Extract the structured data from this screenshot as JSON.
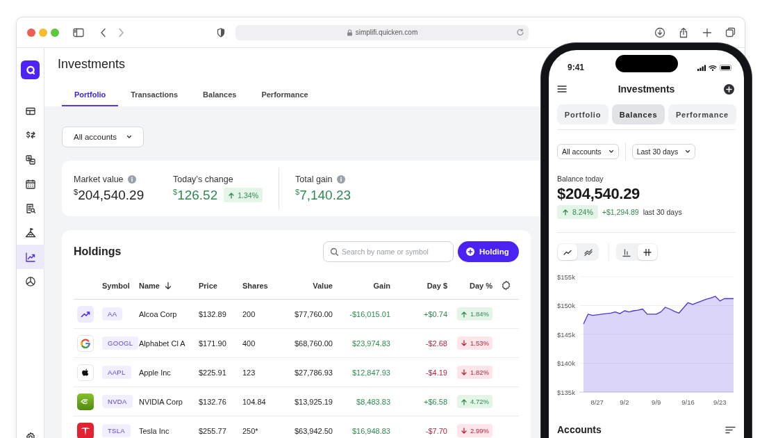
{
  "browser": {
    "address": "simplifi.quicken.com"
  },
  "sidebar": {
    "items": [
      {
        "selected": false
      },
      {
        "selected": false
      },
      {
        "selected": false
      },
      {
        "selected": false
      },
      {
        "selected": false
      },
      {
        "selected": false
      },
      {
        "selected": true
      },
      {
        "selected": false
      }
    ]
  },
  "page": {
    "title": "Investments",
    "tabs": [
      {
        "label": "Portfolio",
        "selected": true
      },
      {
        "label": "Transactions",
        "selected": false
      },
      {
        "label": "Balances",
        "selected": false
      },
      {
        "label": "Performance",
        "selected": false
      }
    ],
    "account_filter": "All accounts"
  },
  "summary": {
    "market_value": {
      "label": "Market value",
      "value": "$^{$}$204,540.29"
    },
    "todays_change": {
      "label": "Today’s change",
      "value": "$^{$}$126.52",
      "badge": "1.34%",
      "rising": true
    },
    "total_gain": {
      "label": "Total gain",
      "value": "$^{$}$7,140.23"
    }
  },
  "holdings": {
    "title": "Holdings",
    "search": {
      "placeholder": "Search by name or symbol"
    },
    "add_button": "Holding",
    "columns": [
      {
        "label": "Symbol",
        "sorted": false
      },
      {
        "label": "Name",
        "sorted": true
      },
      {
        "label": "Price",
        "sorted": false
      },
      {
        "label": "Shares",
        "sorted": false
      },
      {
        "label": "Value",
        "sorted": false
      },
      {
        "label": "Gain",
        "sorted": false
      },
      {
        "label": "Day $",
        "sorted": false
      },
      {
        "label": "Day %",
        "sorted": false
      }
    ],
    "rows": [
      {
        "symbol": "AA",
        "name": "Alcoa Corp",
        "price": "$132.89",
        "shares": "200",
        "value": "$77,760.00",
        "gain": "-$16,015.01",
        "day_change": "+$0.74",
        "day_percent": "1.84%",
        "rising": true
      },
      {
        "symbol": "GOOGL",
        "name": "Alphabet Cl A",
        "price": "$171.90",
        "shares": "400",
        "value": "$68,760.00",
        "gain": "$23,974.83",
        "day_change": "-$2.68",
        "day_percent": "1.53%",
        "rising": false
      },
      {
        "symbol": "AAPL",
        "name": "Apple Inc",
        "price": "$225.91",
        "shares": "123",
        "value": "$27,786.93",
        "gain": "$12,847.93",
        "day_change": "-$4.19",
        "day_percent": "1.82%",
        "rising": false
      },
      {
        "symbol": "NVDA",
        "name": "NVIDIA Corp",
        "price": "$132.76",
        "shares": "104.84",
        "value": "$13,925.19",
        "gain": "$8,483.83",
        "day_change": "+$6.58",
        "day_percent": "4.72%",
        "rising": true
      },
      {
        "symbol": "TSLA",
        "name": "Tesla Inc",
        "price": "$255.77",
        "shares": "250*",
        "value": "$63,942.50",
        "gain": "$16,948.83",
        "day_change": "-$7.70",
        "day_percent": "2.99%",
        "rising": false
      }
    ]
  },
  "phone": {
    "time": "9:41",
    "title": "Investments",
    "tabs": [
      {
        "label": "Portfolio",
        "selected": false
      },
      {
        "label": "Balances",
        "selected": true
      },
      {
        "label": "Performance",
        "selected": false
      }
    ],
    "filters": [
      "All accounts",
      "Last 30 days"
    ],
    "balance_label": "Balance today",
    "balance": "$204,540.29",
    "change_badge": "8.24%",
    "rising": true,
    "change_amount": "+$1,294.89",
    "period": "last 30 days",
    "chart_toggles": [
      {
        "selected": true
      },
      {
        "selected": false
      },
      {
        "selected": false
      },
      {
        "selected": true
      }
    ],
    "chart_data": {
      "type": "area",
      "categories": [
        null,
        null,
        null,
        "8/27",
        null,
        null,
        null,
        null,
        null,
        "9/2",
        null,
        null,
        null,
        null,
        null,
        null,
        "9/9",
        null,
        null,
        null,
        null,
        null,
        null,
        "9/16",
        null,
        null,
        null,
        null,
        null,
        null,
        "9/23",
        null,
        null,
        null
      ],
      "series": [
        {
          "color": "#4b33d6",
          "values": [
            146800,
            148500,
            148300,
            148400,
            148500,
            148600,
            148700,
            148900,
            148600,
            149100,
            148900,
            149100,
            149200,
            149400,
            148500,
            148500,
            148500,
            148900,
            149700,
            149400,
            149000,
            148700,
            149600,
            150500,
            150200,
            150500,
            150800,
            151100,
            151300,
            151600,
            150800,
            151200,
            151200,
            151200
          ]
        }
      ],
      "ylim": [
        135000,
        155000
      ],
      "grid": true,
      "yticks": [
        {
          "value": 155000,
          "label": "$155k"
        },
        {
          "value": 150000,
          "label": "$150k"
        },
        {
          "value": 145000,
          "label": "$145k"
        },
        {
          "value": 140000,
          "label": "$140k"
        },
        {
          "value": 135000,
          "label": "$135k"
        }
      ]
    },
    "accounts_title": "Accounts"
  }
}
